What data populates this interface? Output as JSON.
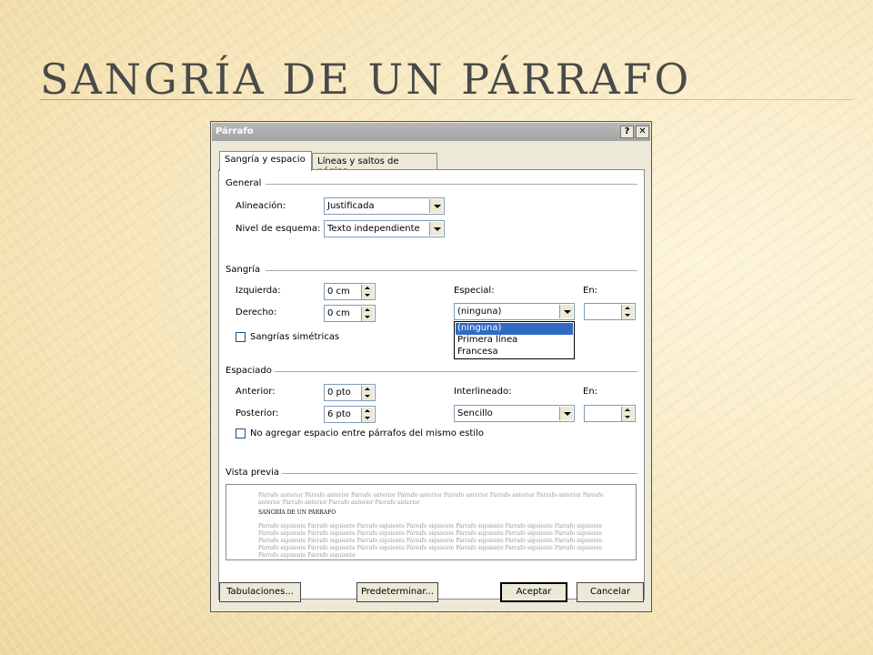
{
  "slide": {
    "title": "Sangría de un párrafo"
  },
  "dialog": {
    "title": "Párrafo",
    "help_btn": "?",
    "close_btn": "✕",
    "tabs": [
      "Sangría y espacio",
      "Líneas y saltos de página"
    ],
    "general": {
      "heading": "General",
      "alignment_label": "Alineación:",
      "alignment_value": "Justificada",
      "outline_label": "Nivel de esquema:",
      "outline_value": "Texto independiente"
    },
    "indent": {
      "heading": "Sangría",
      "left_label": "Izquierda:",
      "left_value": "0 cm",
      "right_label": "Derecho:",
      "right_value": "0 cm",
      "special_label": "Especial:",
      "special_value": "(ninguna)",
      "by_label": "En:",
      "by_value": "",
      "mirror_label": "Sangrías simétricas",
      "special_options": [
        "(ninguna)",
        "Primera línea",
        "Francesa"
      ]
    },
    "spacing": {
      "heading": "Espaciado",
      "before_label": "Anterior:",
      "before_value": "0 pto",
      "after_label": "Posterior:",
      "after_value": "6 pto",
      "line_label": "Interlineado:",
      "line_value": "Sencillo",
      "at_label": "En:",
      "at_value": "",
      "no_space_label": "No agregar espacio entre párrafos del mismo estilo"
    },
    "preview": {
      "heading": "Vista previa",
      "prev_text": "Párrafo anterior Párrafo anterior Párrafo anterior Párrafo anterior Párrafo anterior Párrafo anterior Párrafo anterior Párrafo anterior Párrafo anterior Párrafo anterior Párrafo anterior",
      "current_text": "SANGRÍA DE UN PÁRRAFO",
      "next_text": "Párrafo siguiente Párrafo siguiente Párrafo siguiente Párrafo siguiente Párrafo siguiente Párrafo siguiente Párrafo siguiente Párrafo siguiente Párrafo siguiente Párrafo siguiente Párrafo siguiente Párrafo siguiente Párrafo siguiente Párrafo siguiente Párrafo siguiente Párrafo siguiente Párrafo siguiente Párrafo siguiente Párrafo siguiente Párrafo siguiente Párrafo siguiente Párrafo siguiente Párrafo siguiente Párrafo siguiente Párrafo siguiente Párrafo siguiente Párrafo siguiente Párrafo siguiente Párrafo siguiente Párrafo siguiente"
    },
    "buttons": {
      "tabs": "Tabulaciones...",
      "default": "Predeterminar...",
      "ok": "Aceptar",
      "cancel": "Cancelar"
    }
  }
}
